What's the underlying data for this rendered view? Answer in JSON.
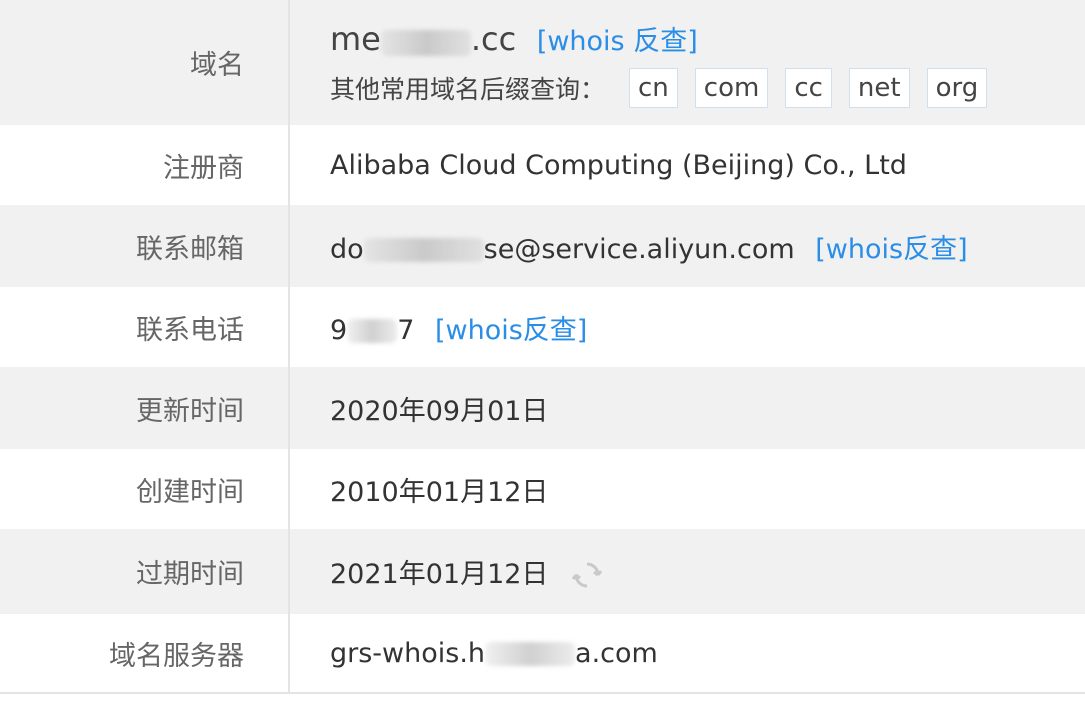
{
  "rows": {
    "domain": {
      "label": "域名",
      "value_prefix": "me",
      "value_suffix": ".cc",
      "whois_link": "[whois 反查]",
      "suffix_label": "其他常用域名后缀查询：",
      "suffixes": [
        "cn",
        "com",
        "cc",
        "net",
        "org"
      ]
    },
    "registrar": {
      "label": "注册商",
      "value": "Alibaba Cloud Computing (Beijing) Co., Ltd"
    },
    "email": {
      "label": "联系邮箱",
      "value_prefix": "do",
      "value_suffix": "se@service.aliyun.com",
      "whois_link": "[whois反查]"
    },
    "phone": {
      "label": "联系电话",
      "value_prefix": "9",
      "value_suffix": "7",
      "whois_link": "[whois反查]"
    },
    "updated": {
      "label": "更新时间",
      "value": "2020年09月01日"
    },
    "created": {
      "label": "创建时间",
      "value": "2010年01月12日"
    },
    "expires": {
      "label": "过期时间",
      "value": "2021年01月12日"
    },
    "nameserver": {
      "label": "域名服务器",
      "value_prefix": "grs-whois.h",
      "value_suffix": "a.com"
    }
  },
  "icons": {
    "refresh": "refresh-icon"
  },
  "colors": {
    "link": "#2a8ee6",
    "row_gray": "#f1f1f1",
    "label": "#666666"
  }
}
